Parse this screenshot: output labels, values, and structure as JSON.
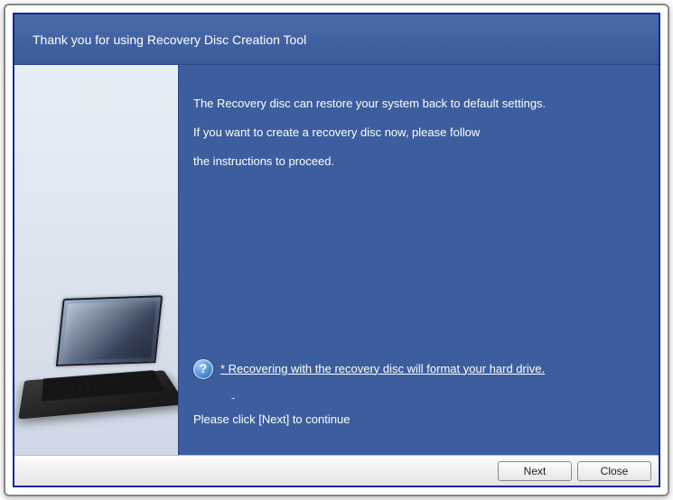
{
  "header": {
    "title": "Thank you for using Recovery Disc Creation Tool"
  },
  "content": {
    "line1": "The Recovery disc can restore your system back to default settings.",
    "line2": "If you want to create a recovery disc now, please follow",
    "line3": "the instructions to proceed.",
    "warning_text": "* Recovering with the recovery disc will format your hard drive.",
    "dash": "-",
    "continue_text": "Please click [Next] to continue",
    "help_glyph": "?"
  },
  "footer": {
    "next_label": "Next",
    "close_label": "Close"
  }
}
